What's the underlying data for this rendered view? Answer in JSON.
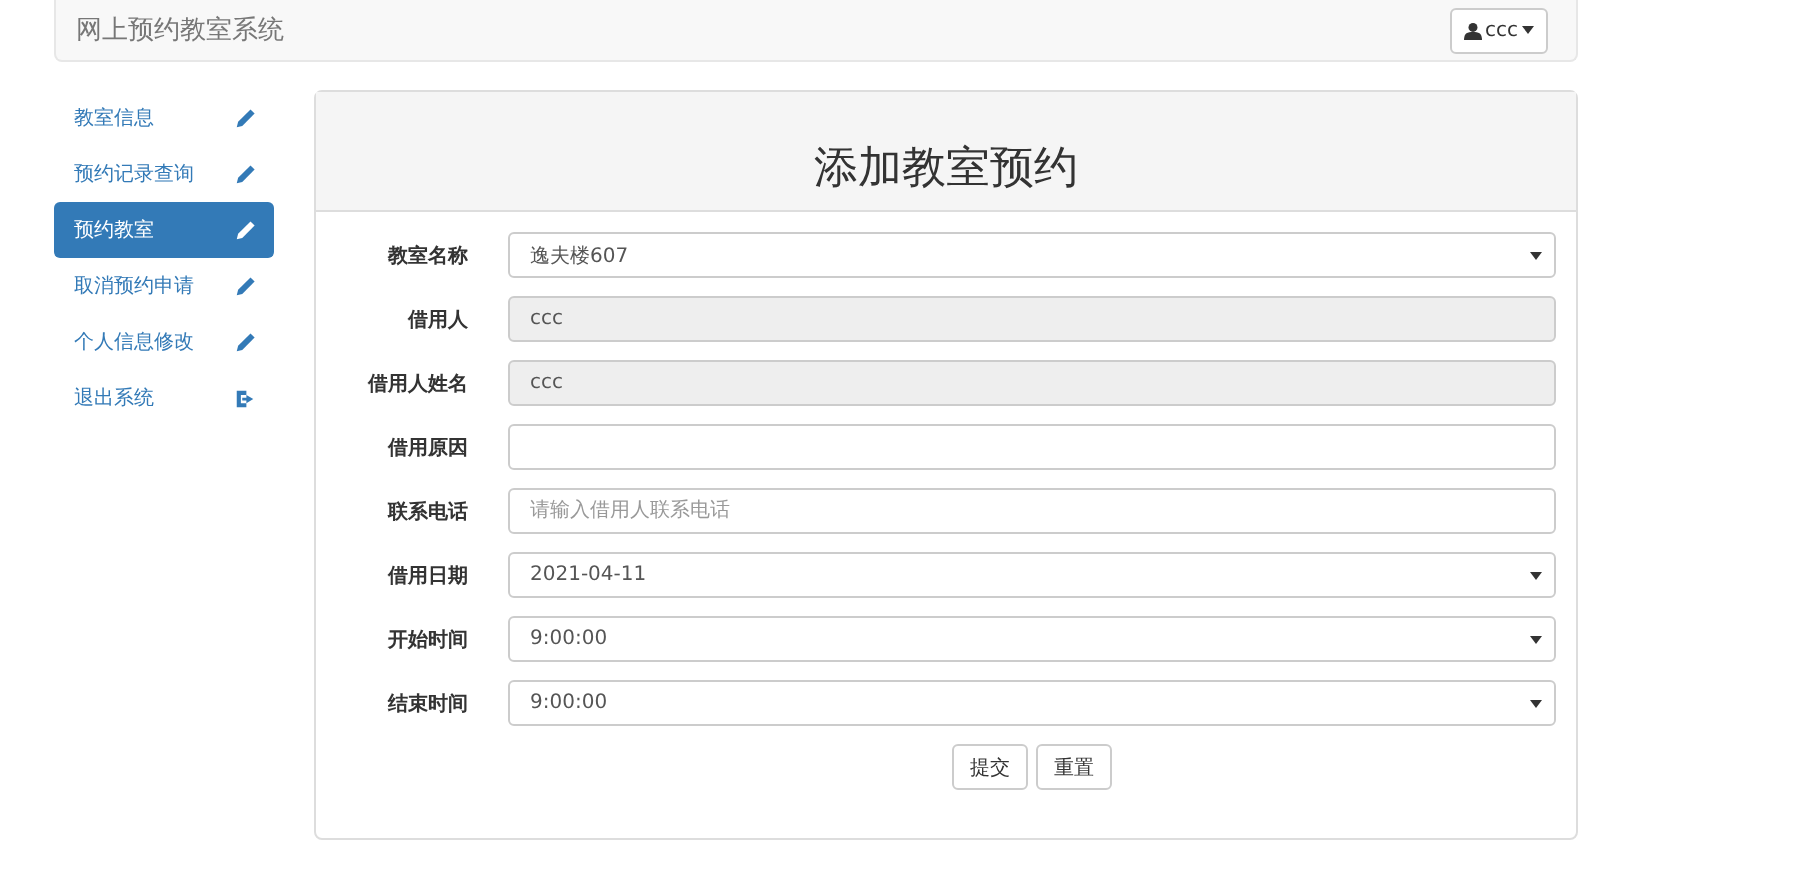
{
  "navbar": {
    "brand": "网上预约教室系统",
    "user_menu": {
      "label": "ccc"
    }
  },
  "sidebar": {
    "items": [
      {
        "label": "教室信息",
        "kind": "edit",
        "selected": false
      },
      {
        "label": "预约记录查询",
        "kind": "edit",
        "selected": false
      },
      {
        "label": "预约教室",
        "kind": "edit",
        "selected": true
      },
      {
        "label": "取消预约申请",
        "kind": "edit",
        "selected": false
      },
      {
        "label": "个人信息修改",
        "kind": "edit",
        "selected": false
      },
      {
        "label": "退出系统",
        "kind": "exit",
        "selected": false
      }
    ]
  },
  "panel": {
    "title": "添加教室预约",
    "fields": [
      {
        "label": "教室名称",
        "kind": "select",
        "value": "逸夫楼607"
      },
      {
        "label": "借用人",
        "kind": "text",
        "value": "ccc",
        "disabled": true
      },
      {
        "label": "借用人姓名",
        "kind": "text",
        "value": "ccc",
        "disabled": true
      },
      {
        "label": "借用原因",
        "kind": "text",
        "disabled": false
      },
      {
        "label": "联系电话",
        "kind": "text",
        "placeholder": "请输入借用人联系电话",
        "disabled": false
      },
      {
        "label": "借用日期",
        "kind": "select",
        "value": "2021-04-11"
      },
      {
        "label": "开始时间",
        "kind": "select",
        "value": "9:00:00"
      },
      {
        "label": "结束时间",
        "kind": "select",
        "value": "9:00:00"
      }
    ],
    "buttons": [
      "提交",
      "重置"
    ]
  }
}
